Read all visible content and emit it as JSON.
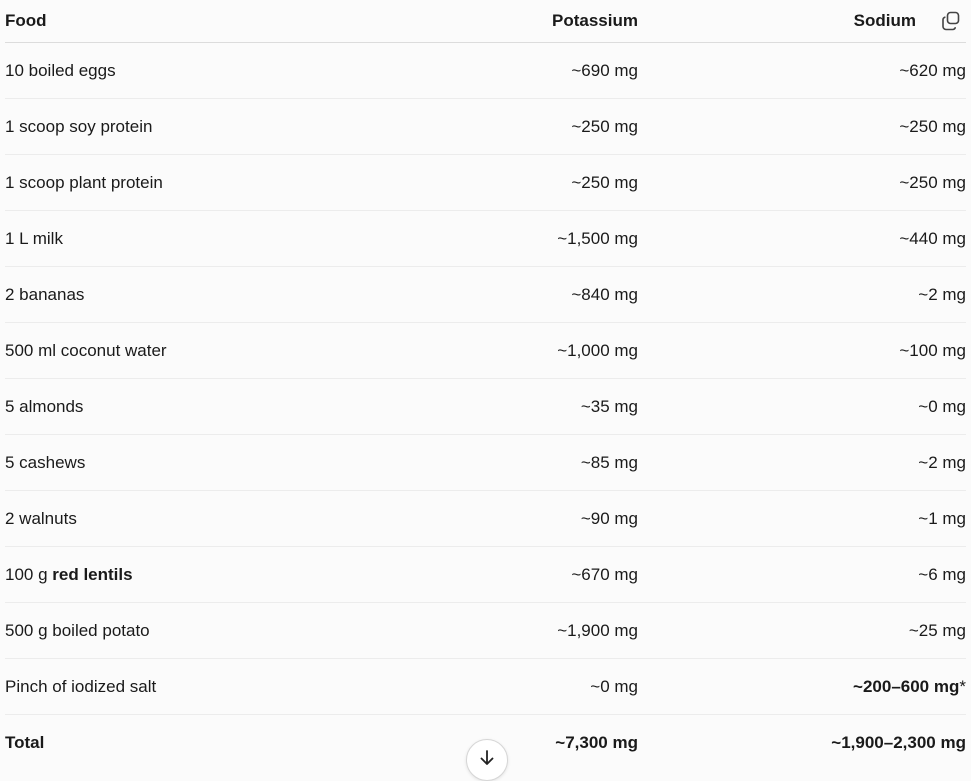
{
  "table": {
    "headers": {
      "food": "Food",
      "potassium": "Potassium",
      "sodium": "Sodium"
    },
    "rows": [
      {
        "food_pre": "10 boiled eggs",
        "potassium": "~690 mg",
        "sodium": "~620 mg"
      },
      {
        "food_pre": "1 scoop soy protein",
        "potassium": "~250 mg",
        "sodium": "~250 mg"
      },
      {
        "food_pre": "1 scoop plant protein",
        "potassium": "~250 mg",
        "sodium": "~250 mg"
      },
      {
        "food_pre": "1 L milk",
        "potassium": "~1,500 mg",
        "sodium": "~440 mg"
      },
      {
        "food_pre": "2 bananas",
        "potassium": "~840 mg",
        "sodium": "~2 mg"
      },
      {
        "food_pre": "500 ml coconut water",
        "potassium": "~1,000 mg",
        "sodium": "~100 mg"
      },
      {
        "food_pre": "5 almonds",
        "potassium": "~35 mg",
        "sodium": "~0 mg"
      },
      {
        "food_pre": "5 cashews",
        "potassium": "~85 mg",
        "sodium": "~2 mg"
      },
      {
        "food_pre": "2 walnuts",
        "potassium": "~90 mg",
        "sodium": "~1 mg"
      },
      {
        "food_pre": "100 g ",
        "food_bold": "red lentils",
        "potassium": "~670 mg",
        "sodium": "~6 mg"
      },
      {
        "food_pre": "500 g boiled potato",
        "potassium": "~1,900 mg",
        "sodium": "~25 mg"
      },
      {
        "food_pre": "Pinch of iodized salt",
        "potassium": "~0 mg",
        "sodium_bold": "~200–600 mg",
        "sodium_suffix": "*"
      }
    ],
    "total": {
      "label": "Total",
      "potassium": "~7,300 mg",
      "sodium": "~1,900–2,300 mg"
    }
  },
  "icons": {
    "copy": "copy-icon",
    "scroll_down": "arrow-down-icon"
  }
}
